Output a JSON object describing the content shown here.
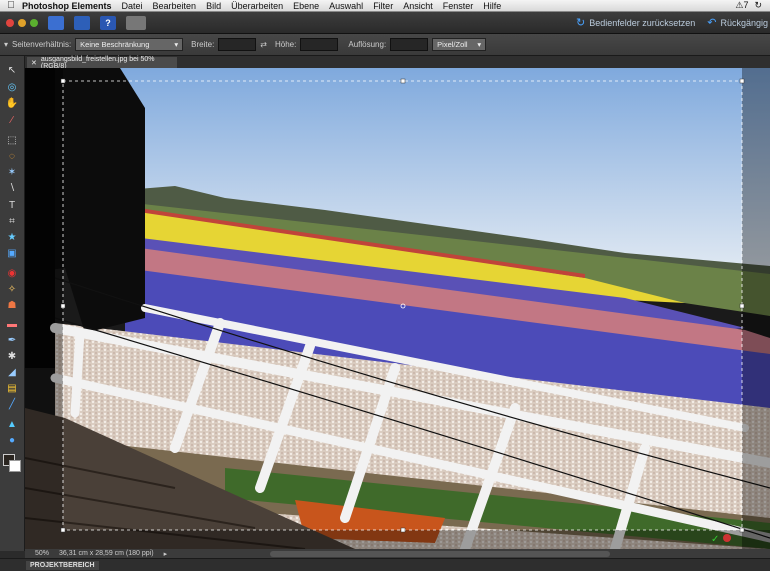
{
  "menubar": {
    "app_name": "Photoshop Elements",
    "items": [
      "Datei",
      "Bearbeiten",
      "Bild",
      "Überarbeiten",
      "Ebene",
      "Auswahl",
      "Filter",
      "Ansicht",
      "Fenster",
      "Hilfe"
    ],
    "status_number": "7"
  },
  "appbar": {
    "reset_panels": "Bedienfelder zurücksetzen",
    "undo": "Rückgängig"
  },
  "options": {
    "aspect_label": "Seitenverhältnis:",
    "aspect_value": "Keine Beschränkung",
    "width_label": "Breite:",
    "width_value": "",
    "height_label": "Höhe:",
    "height_value": "",
    "resolution_label": "Auflösung:",
    "resolution_value": "",
    "resolution_unit": "Pixel/Zoll"
  },
  "document": {
    "tab_title": "ausgangsbild_freistellen.jpg bei 50% (RGB/8)"
  },
  "status": {
    "zoom": "50%",
    "size_info": "36,31 cm x 28,59 cm (180 ppi)"
  },
  "project": {
    "label": "PROJEKTBEREICH"
  },
  "colors": {
    "sky": "#8fb7e6",
    "yellow_field": "#e6d534",
    "purple_field": "#5a51b6",
    "pink_field": "#c27784",
    "white_field": "#e5d9d0"
  }
}
